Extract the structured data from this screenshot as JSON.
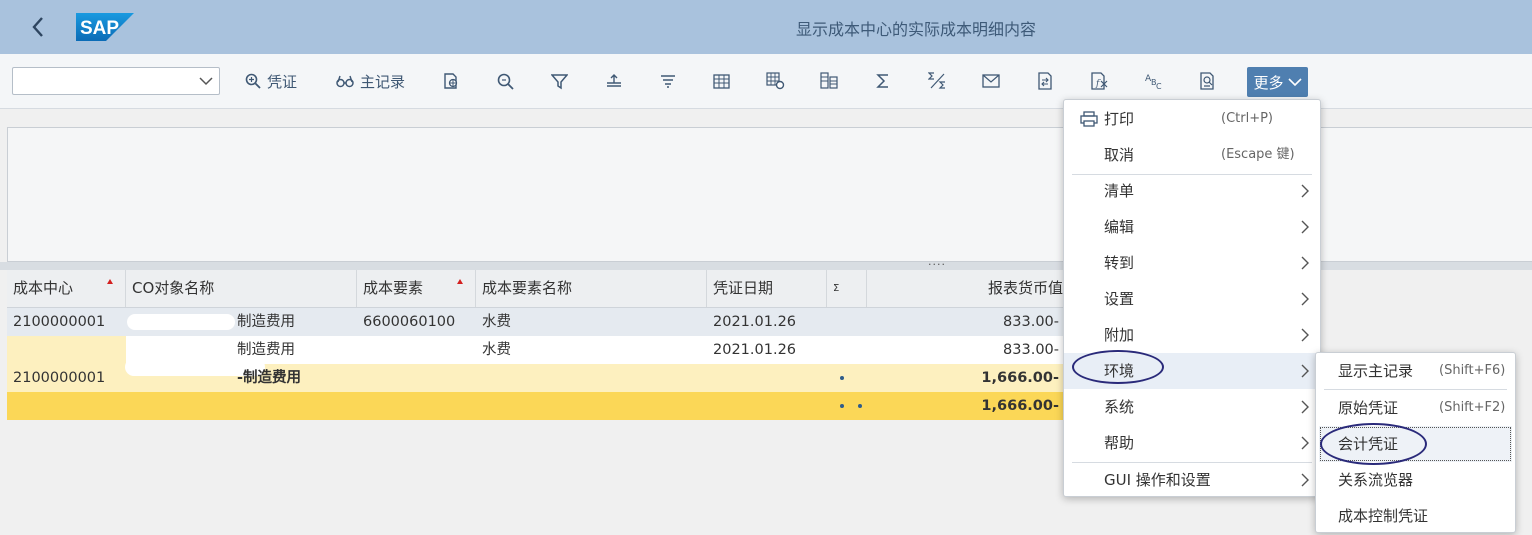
{
  "shell": {
    "title": "显示成本中心的实际成本明细内容",
    "logo_text": "SAP"
  },
  "toolbar": {
    "variant_value": "",
    "doc_label": "凭证",
    "master_label": "主记录",
    "more_label": "更多"
  },
  "table": {
    "columns": [
      "成本中心",
      "CO对象名称",
      "成本要素",
      "成本要素名称",
      "凭证日期",
      "Σ",
      "报表货币值"
    ],
    "rows": [
      {
        "cost_center": "2100000001",
        "co_object": "制造费用",
        "cost_element": "6600060100",
        "element_name": "水费",
        "date": "2021.01.26",
        "value": "833.00-"
      },
      {
        "cost_center": "",
        "co_object": "制造费用",
        "cost_element": "",
        "element_name": "水费",
        "date": "2021.01.26",
        "value": "833.00-"
      },
      {
        "cost_center": "2100000001",
        "co_object": "-制造费用",
        "cost_element": "",
        "element_name": "",
        "date": "",
        "value": "1,666.00-"
      },
      {
        "cost_center": "",
        "co_object": "",
        "cost_element": "",
        "element_name": "",
        "date": "",
        "value": "1,666.00-"
      }
    ]
  },
  "menu": {
    "items": [
      {
        "label": "打印",
        "shortcut": "(Ctrl+P)"
      },
      {
        "label": "取消",
        "shortcut": "(Escape 键)"
      },
      {
        "label": "清单"
      },
      {
        "label": "编辑"
      },
      {
        "label": "转到"
      },
      {
        "label": "设置"
      },
      {
        "label": "附加"
      },
      {
        "label": "环境"
      },
      {
        "label": "系统"
      },
      {
        "label": "帮助"
      },
      {
        "label": "GUI 操作和设置"
      }
    ]
  },
  "submenu": {
    "items": [
      {
        "label": "显示主记录",
        "shortcut": "(Shift+F6)"
      },
      {
        "label": "原始凭证",
        "shortcut": "(Shift+F2)"
      },
      {
        "label": "会计凭证"
      },
      {
        "label": "关系流览器"
      },
      {
        "label": "成本控制凭证"
      }
    ]
  },
  "colors": {
    "shell_bg": "#a9c2dd",
    "accent": "#4f7fb0",
    "subtotal_row": "#fdf0bf",
    "total_row": "#fbd757"
  }
}
